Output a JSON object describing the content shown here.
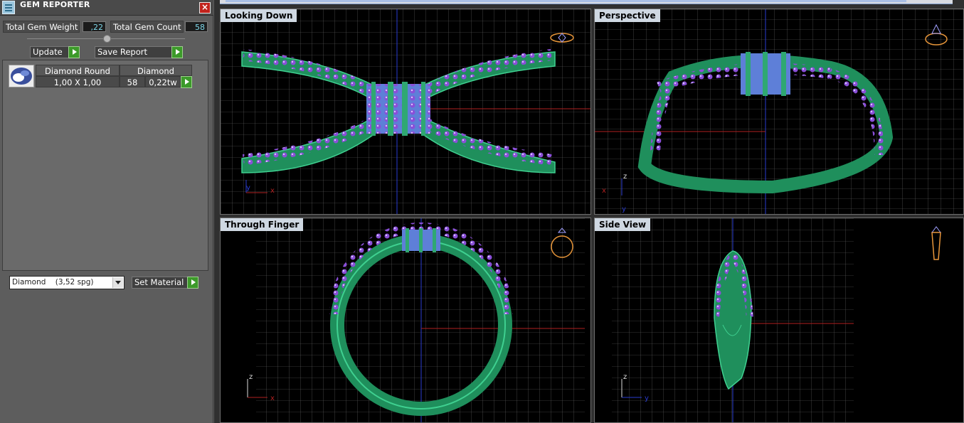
{
  "panel": {
    "title": "GEM REPORTER",
    "close_label": "×",
    "total_gem_weight_label": "Total Gem Weight",
    "total_gem_weight_value": ",22",
    "total_gem_count_label": "Total Gem Count",
    "total_gem_count_value": "58",
    "update_label": "Update",
    "save_report_label": "Save Report",
    "set_material_label": "Set Material",
    "material_selected": "Diamond    (3,52 spg)"
  },
  "gem_table": {
    "headers": [
      "Diamond Round",
      "Diamond"
    ],
    "row": {
      "size": "1,00 X 1,00",
      "count": "58",
      "weight": "0,22tw"
    }
  },
  "viewports": [
    {
      "label": "Looking Down",
      "axis_h": "x",
      "axis_v": "y"
    },
    {
      "label": "Perspective",
      "axis_h": "x",
      "axis_v": "z",
      "axis_d": "y"
    },
    {
      "label": "Through Finger",
      "axis_h": "x",
      "axis_v": "z"
    },
    {
      "label": "Side View",
      "axis_h": "y",
      "axis_v": "z"
    }
  ],
  "colors": {
    "metal": "#1f8f5c",
    "metal_highlight": "#3fd090",
    "gem": "#8a4fd8",
    "gem_light": "#b6a8ff",
    "grid": "#6a6a6a",
    "axis_blue": "#2a3ccf",
    "axis_red": "#b02020",
    "view_icon": "#e8963a"
  }
}
